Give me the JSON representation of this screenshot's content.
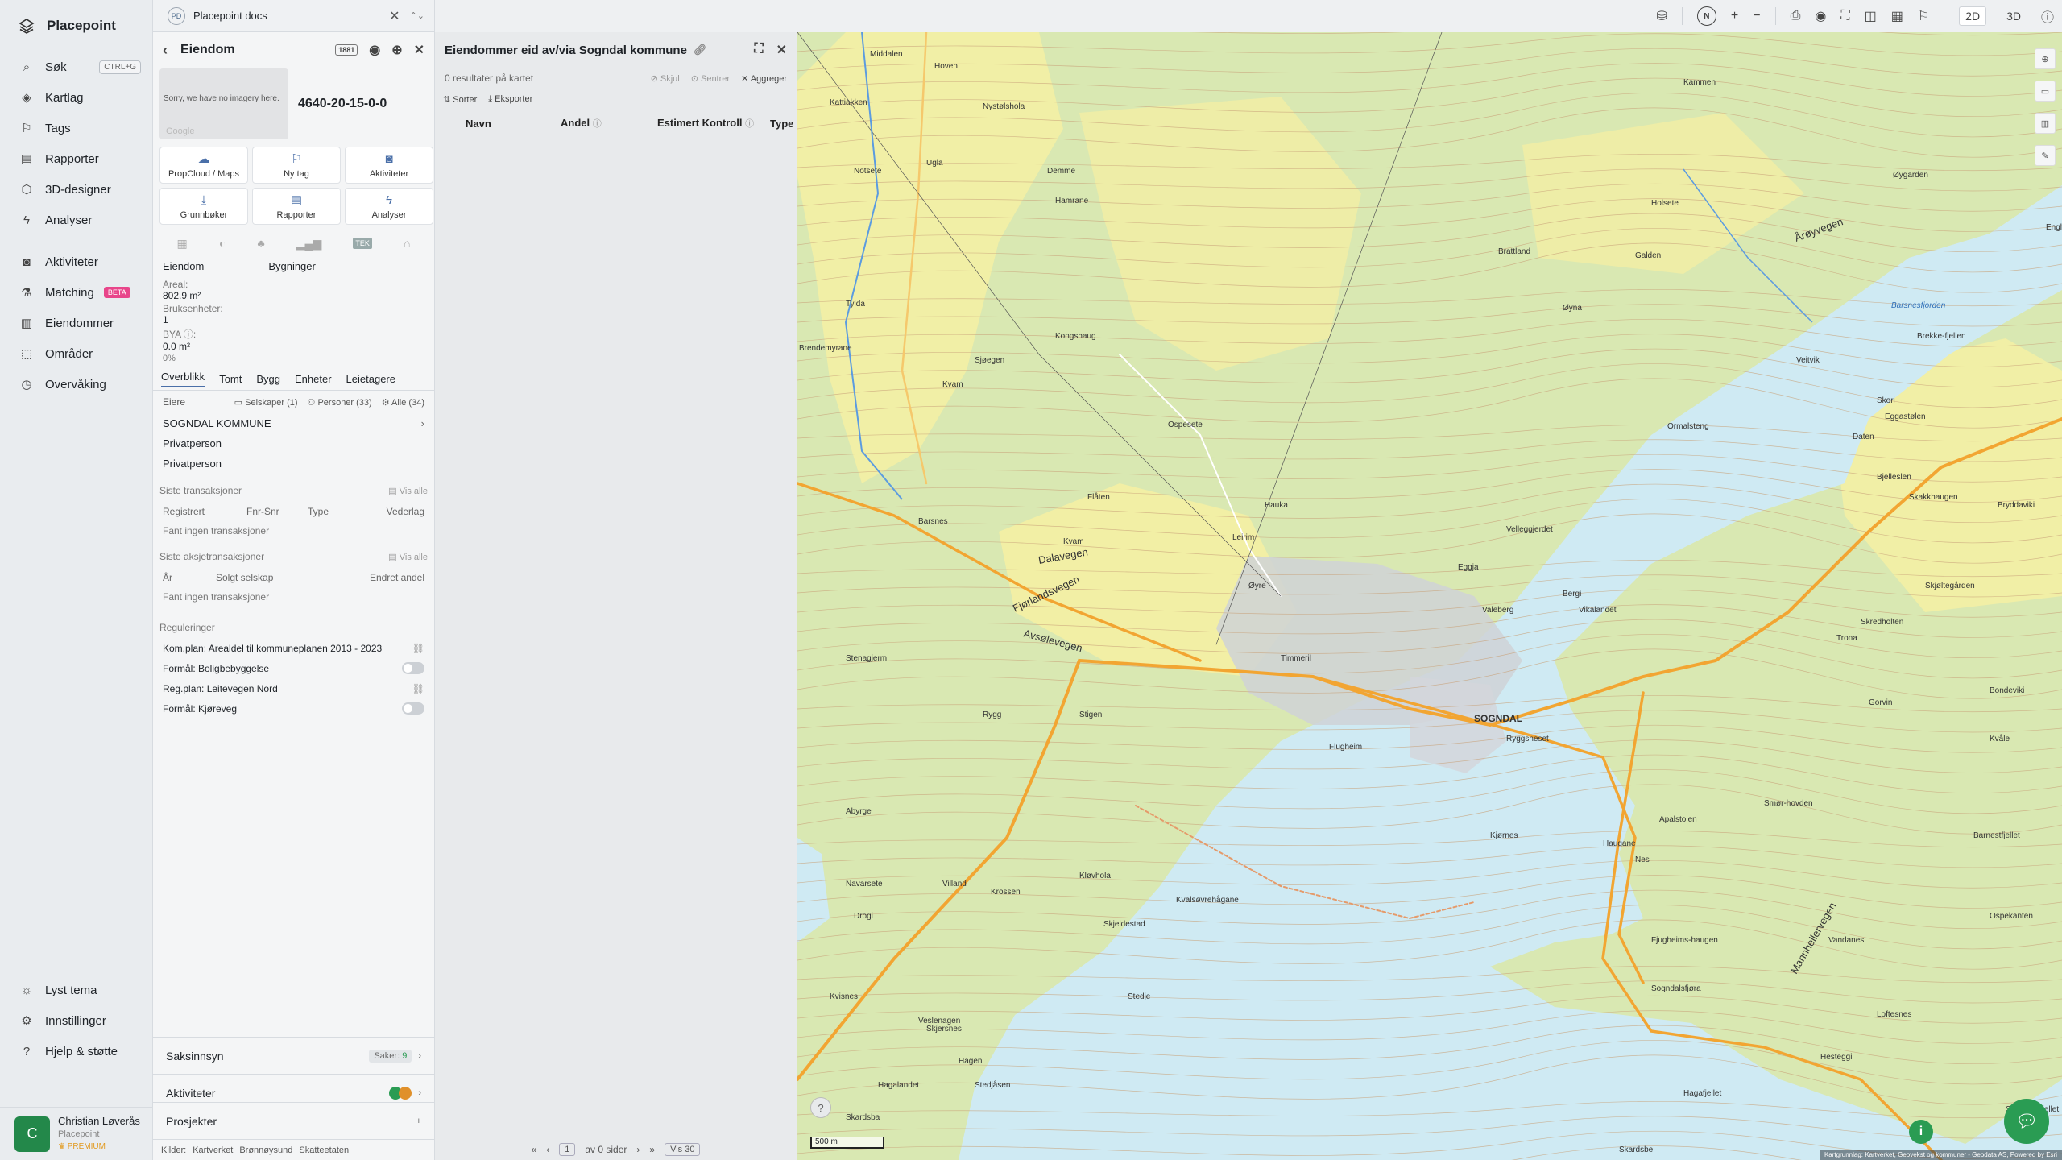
{
  "brand": {
    "name": "Placepoint"
  },
  "nav": {
    "items": [
      {
        "label": "Søk",
        "shortcut": "CTRL+G",
        "icon": "search-icon"
      },
      {
        "label": "Kartlag",
        "icon": "layers-icon"
      },
      {
        "label": "Tags",
        "icon": "bookmark-icon"
      },
      {
        "label": "Rapporter",
        "icon": "chart-icon"
      },
      {
        "label": "3D-designer",
        "icon": "cube-icon"
      },
      {
        "label": "Analyser",
        "icon": "bolt-icon"
      }
    ],
    "items2": [
      {
        "label": "Aktiviteter",
        "icon": "activity-icon"
      },
      {
        "label": "Matching",
        "badge": "BETA",
        "icon": "matching-icon"
      },
      {
        "label": "Eiendommer",
        "icon": "building-icon"
      },
      {
        "label": "Områder",
        "icon": "area-icon"
      },
      {
        "label": "Overvåking",
        "icon": "monitor-icon"
      }
    ],
    "bottom": [
      {
        "label": "Lyst tema",
        "icon": "sun-icon"
      },
      {
        "label": "Innstillinger",
        "icon": "gear-icon"
      },
      {
        "label": "Hjelp & støtte",
        "icon": "help-icon"
      }
    ]
  },
  "user": {
    "initial": "C",
    "name": "Christian Løverås",
    "org": "Placepoint",
    "tier": "PREMIUM"
  },
  "tab": {
    "badge": "PD",
    "label": "Placepoint docs"
  },
  "property": {
    "title": "Eiendom",
    "no_imagery": "Sorry, we have no imagery here.",
    "google": "Google",
    "id": "4640-20-15-0-0",
    "actions": [
      {
        "label": "PropCloud / Maps",
        "icon": "cloud-icon"
      },
      {
        "label": "Ny tag",
        "icon": "bookmark-icon"
      },
      {
        "label": "Aktiviteter",
        "icon": "activity-icon"
      },
      {
        "label": "Grunnbøker",
        "icon": "download-icon"
      },
      {
        "label": "Rapporter",
        "icon": "chart-icon"
      },
      {
        "label": "Analyser",
        "icon": "bolt-icon"
      }
    ],
    "tek_label": "TEK",
    "col1": "Eiendom",
    "col2": "Bygninger",
    "areal_label": "Areal:",
    "areal_value": "802.9",
    "areal_unit": "m²",
    "bruks_label": "Bruksenheter:",
    "bruks_value": "1",
    "bya_label": "BYA",
    "bya_value": "0.0",
    "bya_unit": "m²",
    "bya_pct": "0%",
    "subtabs": [
      "Overblikk",
      "Tomt",
      "Bygg",
      "Enheter",
      "Leietagere"
    ],
    "owners_label": "Eiere",
    "filter_companies": "Selskaper (1)",
    "filter_persons": "Personer (33)",
    "filter_all": "Alle (34)",
    "owners": [
      "SOGNDAL KOMMUNE",
      "Privatperson",
      "Privatperson"
    ],
    "tx_title": "Siste transaksjoner",
    "show_all": "Vis alle",
    "tx_cols": [
      "Registrert",
      "Fnr-Snr",
      "Type",
      "Vederlag"
    ],
    "tx_empty": "Fant ingen transaksjoner",
    "stx_title": "Siste aksjetransaksjoner",
    "stx_cols": [
      "År",
      "Solgt selskap",
      "Endret andel"
    ],
    "stx_empty": "Fant ingen transaksjoner",
    "reg_title": "Reguleringer",
    "regs": [
      {
        "label": "Kom.plan: Arealdel til kommuneplanen 2013 - 2023",
        "kind": "link"
      },
      {
        "label": "Formål: Boligbebyggelse",
        "kind": "toggle"
      },
      {
        "label": "Reg.plan: Leitevegen Nord",
        "kind": "link"
      },
      {
        "label": "Formål: Kjøreveg",
        "kind": "toggle"
      }
    ],
    "saksinnsyn": "Saksinnsyn",
    "saker_label": "Saker:",
    "saker_count": "9",
    "aktiviteter": "Aktiviteter",
    "prosjekter": "Prosjekter",
    "sources_label": "Kilder:",
    "sources": [
      "Kartverket",
      "Brønnøysund",
      "Skatteetaten"
    ]
  },
  "list": {
    "title": "Eiendommer eid av/via Sogndal kommune",
    "results": "0 resultater på kartet",
    "hide": "Skjul",
    "center": "Sentrer",
    "aggregate": "Aggreger",
    "sort": "Sorter",
    "export": "Eksporter",
    "cols": [
      "Navn",
      "Andel",
      "Estimert Kontroll",
      "Type"
    ],
    "pager_page": "1",
    "pager_of": "av 0 sider",
    "pager_show": "Vis 30"
  },
  "topbar": {
    "mode_2d": "2D",
    "mode_3d": "3D",
    "compass": "N"
  },
  "map": {
    "scale": "500 m",
    "attribution": "Kartgrunnlag: Kartverket, Geovekst og kommuner - Geodata AS, Powered by Esri",
    "labels": {
      "town": "SOGNDAL",
      "fjord": "Barsnesfjorden",
      "road1": "Dalavegen",
      "road2": "Fjørlandsvegen",
      "road3": "Avsølevegen",
      "road4": "Årøyvegen",
      "road5": "Mannhellervegen",
      "places": [
        "Middalen",
        "Hoven",
        "Kattiakken",
        "Nystølshola",
        "Kammen",
        "Notsete",
        "Ugla",
        "Demme",
        "Hamrane",
        "Holsete",
        "Galden",
        "Øygarden",
        "England",
        "Brattland",
        "Veitvik",
        "Tylda",
        "Kongshaug",
        "Brendemyrane",
        "Sjøegen",
        "Kvam",
        "Øyna",
        "Ospesete",
        "Ormalsteng",
        "Skori",
        "Daten",
        "Eggastølen",
        "Bjelleslen",
        "Flåten",
        "Skakkhaugen",
        "Barsnes",
        "Bryddaviki",
        "Kvam",
        "Leirim",
        "Hauka",
        "Eggja",
        "Bergi",
        "Trona",
        "Vikalandet",
        "Skredholten",
        "Stenagjerm",
        "Rygg",
        "Stigen",
        "Flugheim",
        "Gorvin",
        "Kvåle",
        "Abyrge",
        "Navarsete",
        "Krossen",
        "Kløvhola",
        "Nes",
        "Fjugheims-haugen",
        "Kvalsøvrehågane",
        "Skjeldestad",
        "Stedje",
        "Sogndalsfjøra",
        "Loftesnes",
        "Hesteggi",
        "Hagafjellet",
        "Skardsbøfjellet",
        "Skardsbe",
        "Stedjåsen",
        "Hagen",
        "Hagalandet",
        "Skardsba",
        "Veslenagen",
        "Skjersnes",
        "Kvisnes",
        "Drogi",
        "Kjørnes",
        "Velleggjerdet",
        "Valeberg",
        "Ryggsneset",
        "Timmeril",
        "Bondeviki",
        "Haugane",
        "Øyre",
        "Villand",
        "Brekke-fjellen",
        "Apalstolen",
        "Smør-hovden",
        "Vandanes",
        "Barnestfjellet",
        "Ospekanten",
        "Skjøltegården"
      ]
    }
  },
  "colors": {
    "accent": "#4a6fa8",
    "green": "#2a9c53",
    "water": "#cfeaf3",
    "road": "#f2a532",
    "forest": "#dbe9b4",
    "field": "#f6f2a6"
  }
}
